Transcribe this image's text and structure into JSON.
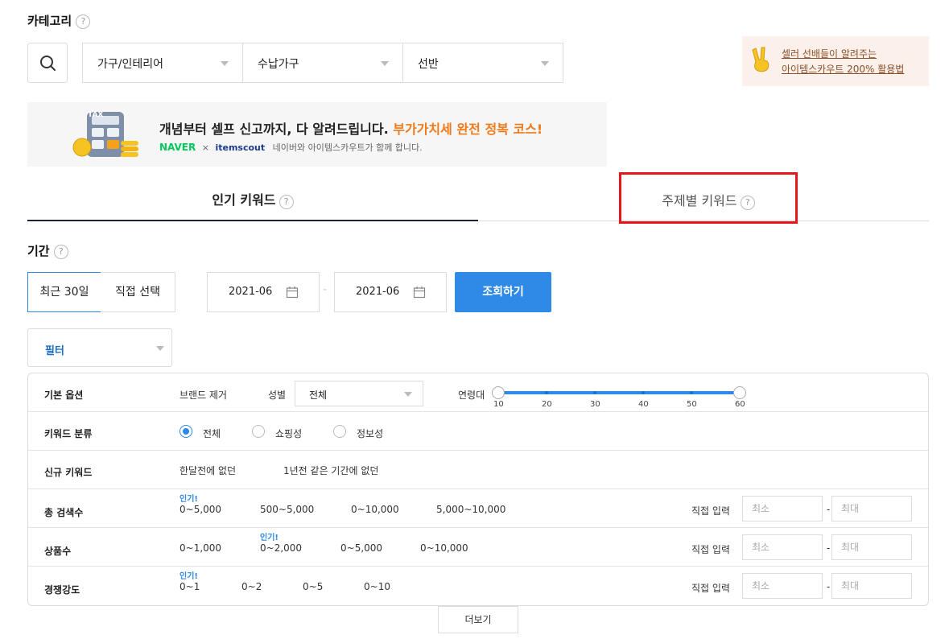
{
  "category": {
    "title": "카테고리",
    "help": "?",
    "selects": [
      "가구/인테리어",
      "수납가구",
      "선반"
    ]
  },
  "promo_side": {
    "line1": "셀러 선배들이 알려주는",
    "line2": "아이템스카우트 200% 활용법"
  },
  "banner": {
    "headline_black": "개념부터 셀프 신고까지, 다 알려드립니다.",
    "headline_orange": "부가가치세 완전 정복 코스!",
    "naver": "NAVER",
    "x": "×",
    "brand": "itemscout",
    "sub": "네이버와 아이템스카우트가 함께 합니다.",
    "calc_label": "TAX"
  },
  "tabs": [
    {
      "label": "인기 키워드",
      "active": true
    },
    {
      "label": "주제별 키워드",
      "active": false
    }
  ],
  "period": {
    "title": "기간",
    "options": [
      "최근 30일",
      "직접 선택"
    ],
    "start": "2021-06",
    "end": "2021-06",
    "search_button": "조회하기"
  },
  "filter_select": "필터",
  "filters": {
    "basic": {
      "label": "기본 옵션",
      "brand": "브랜드 제거",
      "gender_label": "성별",
      "gender_value": "전체",
      "age_label": "연령대",
      "ages": [
        "10",
        "20",
        "30",
        "40",
        "50",
        "60"
      ],
      "age_range": [
        10,
        60
      ]
    },
    "classify": {
      "label": "키워드 분류",
      "options": [
        "전체",
        "쇼핑성",
        "정보성"
      ],
      "selected": "전체"
    },
    "newkw": {
      "label": "신규 키워드",
      "options": [
        "한달전에 없던",
        "1년전 같은 기간에 없던"
      ]
    },
    "total_search": {
      "label": "총 검색수",
      "hot": "인기!",
      "options": [
        "0~5,000",
        "500~5,000",
        "0~10,000",
        "5,000~10,000"
      ],
      "direct": "직접 입력",
      "min": "최소",
      "max": "최대"
    },
    "products": {
      "label": "상품수",
      "hot": "인기!",
      "options": [
        "0~1,000",
        "0~2,000",
        "0~5,000",
        "0~10,000"
      ],
      "direct": "직접 입력",
      "min": "최소",
      "max": "최대"
    },
    "competition": {
      "label": "경쟁강도",
      "hot": "인기!",
      "options": [
        "0~1",
        "0~2",
        "0~5",
        "0~10"
      ],
      "direct": "직접 입력",
      "min": "최소",
      "max": "최대"
    },
    "dash": "-"
  },
  "more_button": "더보기",
  "colors": {
    "accent": "#2e8ae6",
    "orange": "#f07a1a",
    "highlight": "#e8151b",
    "promo_bg": "#fbf1ea",
    "promo_text": "#8a4f2a"
  }
}
